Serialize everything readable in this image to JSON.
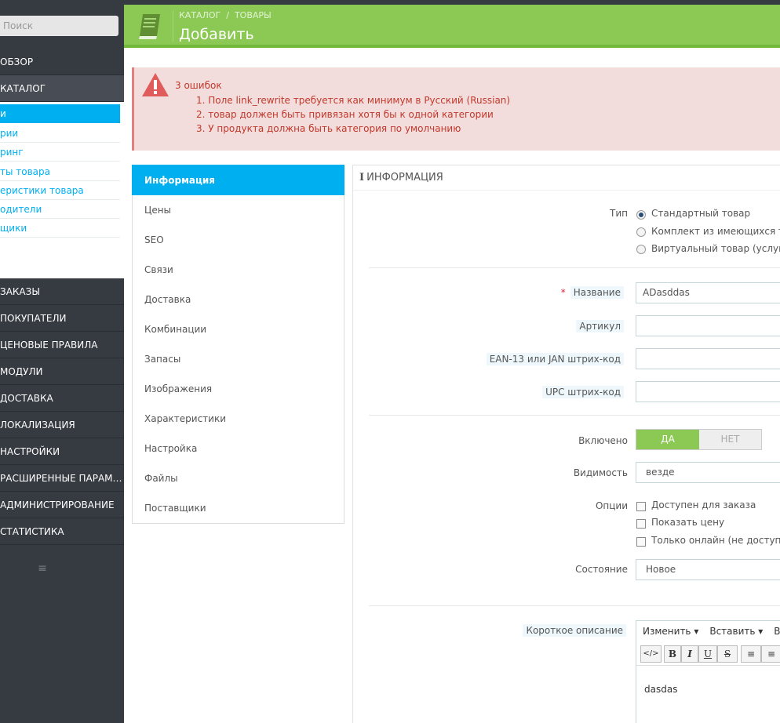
{
  "sidebar": {
    "search_placeholder": "Поиск",
    "menu_top": [
      {
        "label": "Обзор"
      },
      {
        "label": "Каталог"
      }
    ],
    "submenu": [
      {
        "label": "и"
      },
      {
        "label": "рии"
      },
      {
        "label": "ринг"
      },
      {
        "label": "ты товара"
      },
      {
        "label": "еристики товара"
      },
      {
        "label": "одители"
      },
      {
        "label": "щики"
      }
    ],
    "menu_bottom": [
      {
        "label": "Заказы"
      },
      {
        "label": "Покупатели"
      },
      {
        "label": "Ценовые правила"
      },
      {
        "label": "Модули"
      },
      {
        "label": "Доставка"
      },
      {
        "label": "Локализация"
      },
      {
        "label": "Настройки"
      },
      {
        "label": "Расширенные параме..."
      },
      {
        "label": "Администрирование"
      },
      {
        "label": "Статистика"
      }
    ],
    "toggle_icon": "hamburger-icon"
  },
  "header": {
    "icon": "book-icon",
    "breadcrumb": [
      "КАТАЛОГ",
      "ТОВАРЫ"
    ],
    "title": "Добавить",
    "accent": "#8bc954"
  },
  "alert": {
    "icon": "warning-icon",
    "title": "3 ошибок",
    "errors": [
      "1. Поле link_rewrite требуется как минимум в Русский (Russian)",
      "2. товар должен быть привязан хотя бы к одной категории",
      "3. У продукта должна быть категория по умолчанию"
    ]
  },
  "tabs": [
    {
      "label": "Информация"
    },
    {
      "label": "Цены"
    },
    {
      "label": "SEO"
    },
    {
      "label": "Связи"
    },
    {
      "label": "Доставка"
    },
    {
      "label": "Комбинации"
    },
    {
      "label": "Запасы"
    },
    {
      "label": "Изображения"
    },
    {
      "label": "Характеристики"
    },
    {
      "label": "Настройка"
    },
    {
      "label": "Файлы"
    },
    {
      "label": "Поставщики"
    }
  ],
  "form": {
    "heading_icon": "i",
    "heading": "ИНФОРМАЦИЯ",
    "type_label": "Тип",
    "type_options": [
      {
        "label": "Стандартный товар",
        "selected": true
      },
      {
        "label": "Комплект из имеющихся това",
        "selected": false
      },
      {
        "label": "Виртуальный товар (услуги, б",
        "selected": false
      }
    ],
    "required_mark": "*",
    "name_label": "Название",
    "name_value": "ADasddas",
    "sku_label": "Артикул",
    "sku_value": "",
    "ean_label": "EAN-13 или JAN штрих-код",
    "ean_value": "",
    "upc_label": "UPC штрих-код",
    "upc_value": "",
    "enabled_label": "Включено",
    "enabled_yes": "ДА",
    "enabled_no": "НЕТ",
    "visibility_label": "Видимость",
    "visibility_value": "везде",
    "options_label": "Опции",
    "options": [
      {
        "label": "Доступен для заказа",
        "checked": false
      },
      {
        "label": "Показать цену",
        "checked": false
      },
      {
        "label": "Только онлайн (не доступен д",
        "checked": false
      }
    ],
    "condition_label": "Состояние",
    "condition_value": "Новое",
    "short_desc_label": "Короткое описание",
    "editor": {
      "menu": [
        "Изменить ▾",
        "Вставить ▾",
        "Ви"
      ],
      "tools": [
        "</>",
        "B",
        "I",
        "U",
        "S",
        "≡",
        "≡"
      ],
      "content": "dasdas"
    }
  }
}
